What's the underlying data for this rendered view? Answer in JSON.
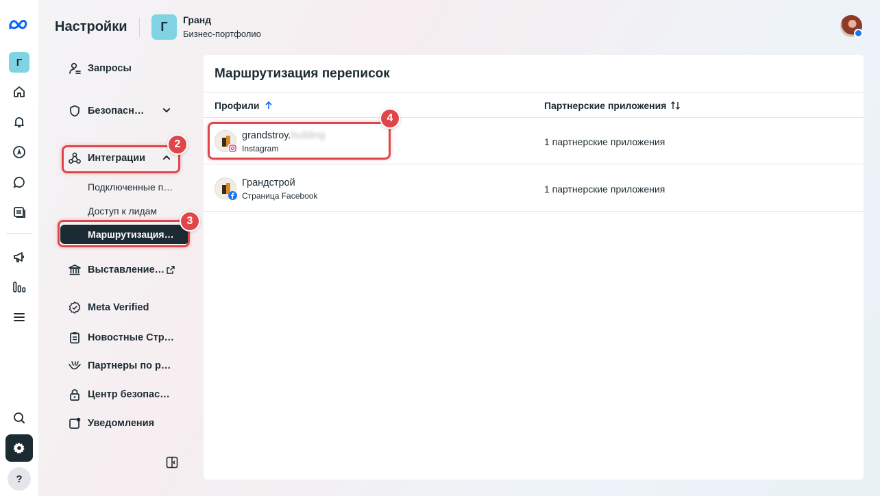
{
  "header": {
    "title": "Настройки",
    "portfolio_initial": "Г",
    "portfolio_name": "Гранд",
    "portfolio_type": "Бизнес-портфолио"
  },
  "rail": {
    "account_initial": "Г",
    "icons": [
      "home-icon",
      "bell-icon",
      "compass-icon",
      "chat-icon",
      "pages-icon",
      "megaphone-icon",
      "bar-chart-icon",
      "menu-icon"
    ],
    "bottom_icons": [
      "search-icon",
      "gear-icon",
      "help-icon"
    ],
    "help_label": "?"
  },
  "nav": {
    "items": [
      {
        "label": "Запросы",
        "icon": "person-request-icon"
      },
      {
        "label": "Безопасн…",
        "icon": "shield-icon"
      },
      {
        "label": "Интеграции",
        "icon": "integrations-icon"
      },
      {
        "label": "Выставление…",
        "icon": "bank-icon"
      },
      {
        "label": "Meta Verified",
        "icon": "verified-badge-icon"
      },
      {
        "label": "Новостные Стр…",
        "icon": "clipboard-icon"
      },
      {
        "label": "Партнеры по р…",
        "icon": "handshake-icon"
      },
      {
        "label": "Центр безопас…",
        "icon": "lock-icon"
      },
      {
        "label": "Уведомления",
        "icon": "notification-square-icon"
      }
    ],
    "integrations_sub": [
      {
        "label": "Подключенные п…"
      },
      {
        "label": "Доступ к лидам"
      },
      {
        "label": "Маршрутизация…",
        "active": true
      }
    ]
  },
  "annotations": {
    "badge_2": "2",
    "badge_3": "3",
    "badge_4": "4",
    "color": "#e0454a"
  },
  "main": {
    "title": "Маршрутизация переписок",
    "columns": [
      "Профили",
      "Партнерские приложения"
    ],
    "rows": [
      {
        "name": "grandstroy.",
        "name_blurred": "building",
        "platform": "Instagram",
        "apps": "1 партнерские приложения"
      },
      {
        "name": "Грандстрой",
        "name_blurred": "",
        "platform": "Страница Facebook",
        "apps": "1 партнерские приложения"
      }
    ]
  },
  "colors": {
    "dark": "#1c2b33",
    "accent_blue": "#0866ff",
    "facebook": "#1877f2",
    "highlight": "#e0454a",
    "account_avatar": "#7fd3e2"
  }
}
